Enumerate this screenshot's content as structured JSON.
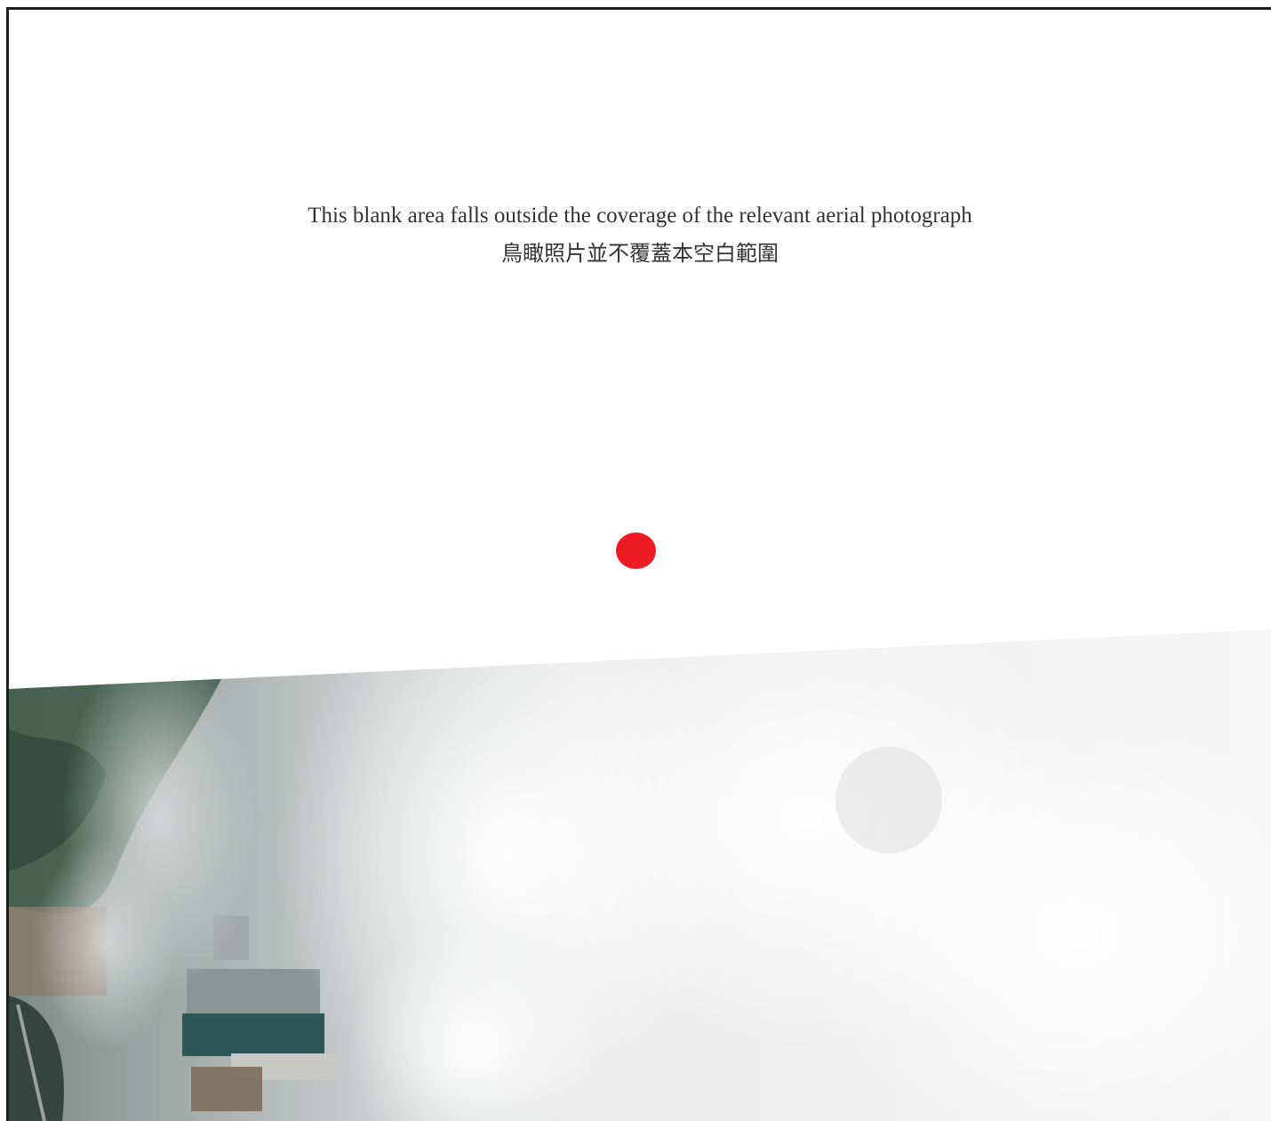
{
  "notice": {
    "line_en": "This blank area falls outside the coverage of the relevant aerial photograph",
    "line_zh": "鳥瞰照片並不覆蓋本空白範圍"
  },
  "colors": {
    "frame": "#1e1e1e",
    "marker": "#ed1c24",
    "text": "#333333"
  },
  "icons": {
    "marker": "location-dot-icon"
  }
}
